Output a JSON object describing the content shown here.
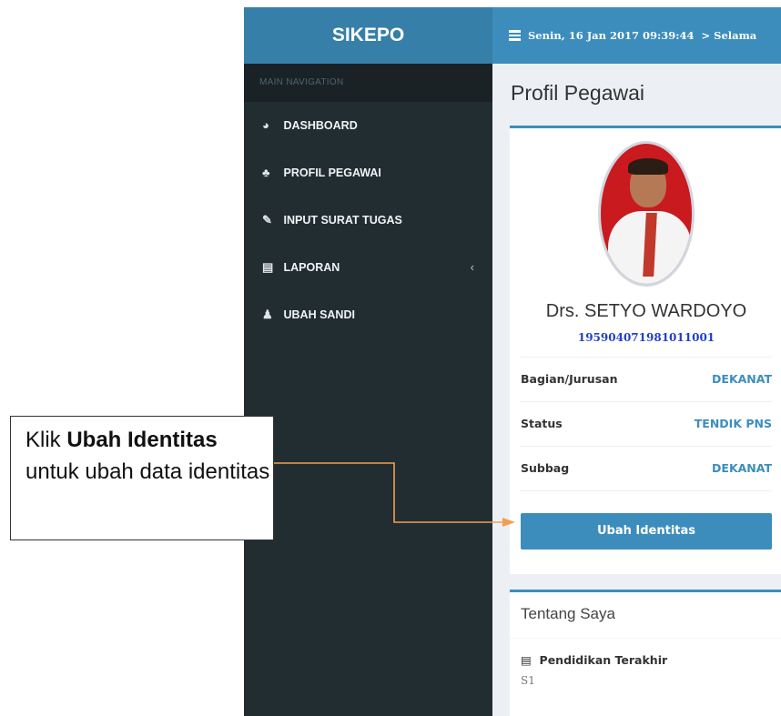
{
  "app": {
    "logo": "SIKEPO",
    "topbar": {
      "datetime_text": "Senin, 16 Jan 2017 09:39:44",
      "greeting_text": "> Selama"
    }
  },
  "sidebar": {
    "header": "MAIN NAVIGATION",
    "items": [
      {
        "label": "DASHBOARD",
        "icon": "dashboard-icon",
        "glyph": "◕"
      },
      {
        "label": "PROFIL PEGAWAI",
        "icon": "user-plus-icon",
        "glyph": "♣"
      },
      {
        "label": "INPUT SURAT TUGAS",
        "icon": "edit-icon",
        "glyph": "✎"
      },
      {
        "label": "LAPORAN",
        "icon": "book-icon",
        "glyph": "▤",
        "chevron": "‹"
      },
      {
        "label": "UBAH SANDI",
        "icon": "user-icon",
        "glyph": "♟"
      }
    ]
  },
  "content": {
    "page_title": "Profil Pegawai",
    "profile": {
      "name": "Drs. SETYO WARDOYO",
      "nip": "195904071981011001",
      "rows": [
        {
          "label": "Bagian/Jurusan",
          "value": "DEKANAT"
        },
        {
          "label": "Status",
          "value": "TENDIK PNS"
        },
        {
          "label": "Subbag",
          "value": "DEKANAT"
        }
      ],
      "button_label": "Ubah Identitas"
    },
    "about": {
      "title": "Tentang Saya",
      "education_label": "Pendidikan Terakhir",
      "education_value": "S1"
    }
  },
  "annotation": {
    "prefix": "Klik ",
    "bold": "Ubah Identitas",
    "suffix": " untuk ubah data identitas",
    "arrow_color": "#f0a050"
  },
  "colors": {
    "primary": "#3c8dbc",
    "logo_bg": "#367fa9",
    "sidebar_bg": "#222d32",
    "nip_color": "#2340c8"
  }
}
